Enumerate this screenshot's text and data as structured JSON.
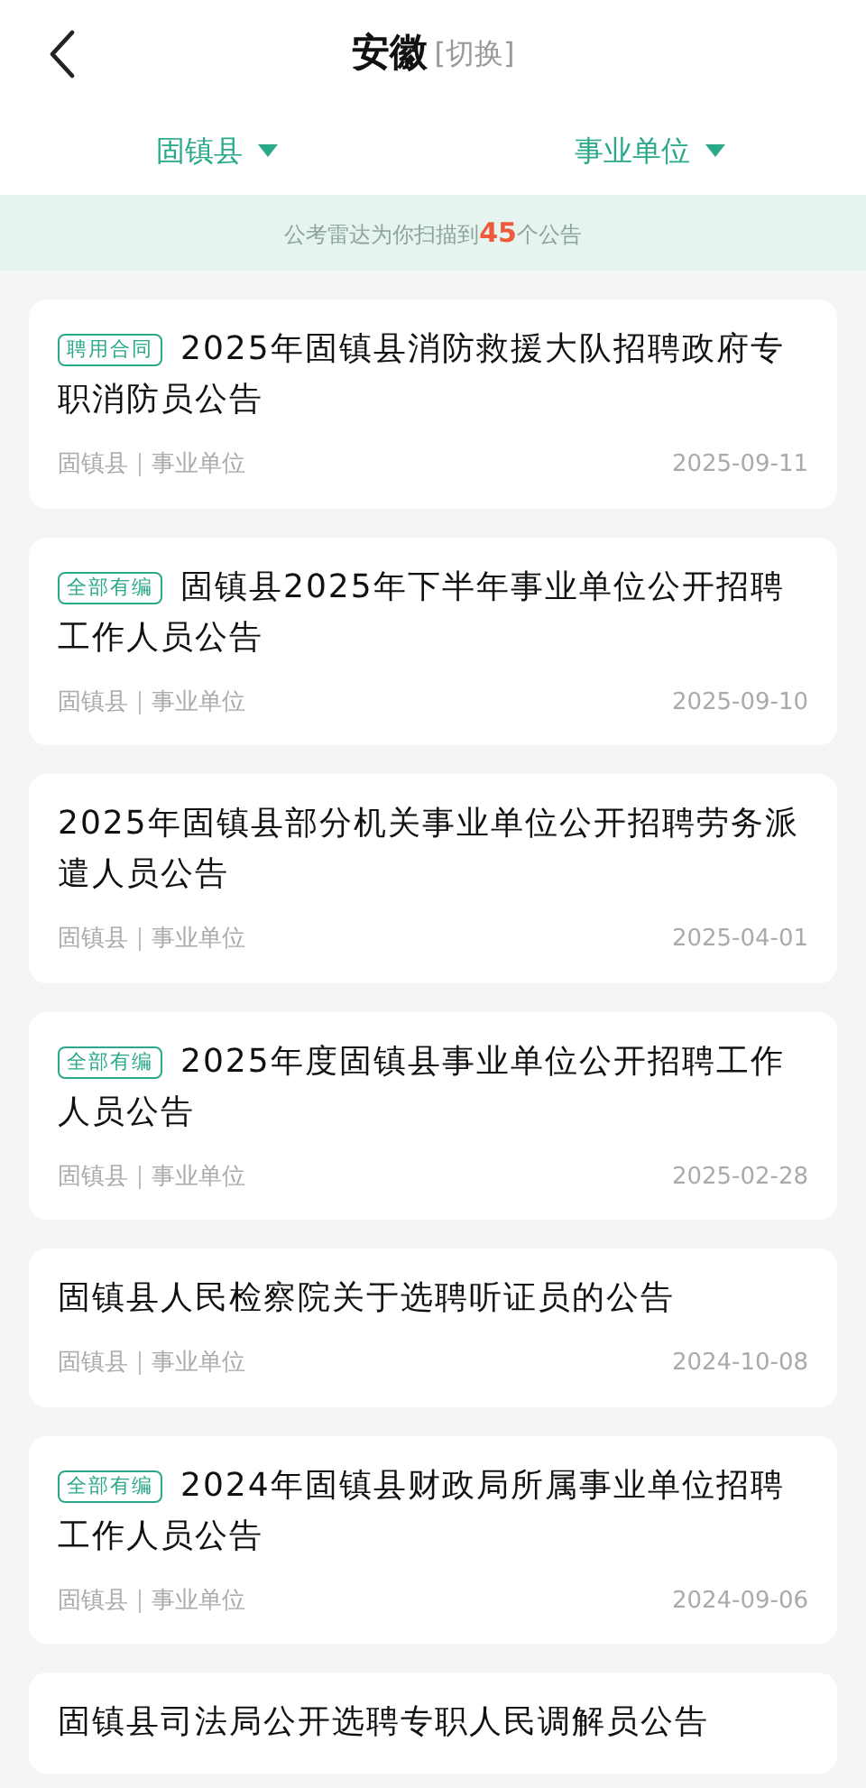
{
  "header": {
    "title": "安徽",
    "switch_label": "[切换]"
  },
  "filters": [
    {
      "label": "固镇县"
    },
    {
      "label": "事业单位"
    }
  ],
  "banner": {
    "prefix": "公考雷达为你扫描到",
    "count": "45",
    "suffix": "个公告"
  },
  "announcements": [
    {
      "tag": "聘用合同",
      "title": "2025年固镇县消防救援大队招聘政府专职消防员公告",
      "region": "固镇县",
      "category": "事业单位",
      "date": "2025-09-11"
    },
    {
      "tag": "全部有编",
      "title": "固镇县2025年下半年事业单位公开招聘工作人员公告",
      "region": "固镇县",
      "category": "事业单位",
      "date": "2025-09-10"
    },
    {
      "title": "2025年固镇县部分机关事业单位公开招聘劳务派遣人员公告",
      "region": "固镇县",
      "category": "事业单位",
      "date": "2025-04-01"
    },
    {
      "tag": "全部有编",
      "title": "2025年度固镇县事业单位公开招聘工作人员公告",
      "region": "固镇县",
      "category": "事业单位",
      "date": "2025-02-28"
    },
    {
      "title": "固镇县人民检察院关于选聘听证员的公告",
      "region": "固镇县",
      "category": "事业单位",
      "date": "2024-10-08"
    },
    {
      "tag": "全部有编",
      "title": "2024年固镇县财政局所属事业单位招聘工作人员公告",
      "region": "固镇县",
      "category": "事业单位",
      "date": "2024-09-06"
    },
    {
      "title": "固镇县司法局公开选聘专职人民调解员公告"
    }
  ]
}
